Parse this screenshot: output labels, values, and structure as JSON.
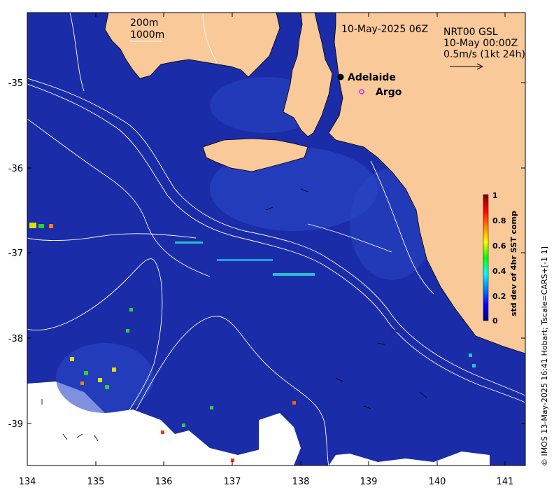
{
  "map": {
    "timestamp": "10-May-2025 06Z",
    "contour_labels": [
      "200m",
      "1000m"
    ],
    "current_source": "NRT00 GSL",
    "current_time": "10-May 00:00Z",
    "vector_scale": "0.5m/s (1kt 24h)",
    "places": [
      {
        "name": "Adelaide",
        "marker": "filled-circle"
      },
      {
        "name": "Argo",
        "marker": "open-circle",
        "color": "#e020e0"
      }
    ],
    "credit": "© IMOS 13-May-2025 16:41 Hobart; Tscale=CARS+[-1 1]",
    "colors": {
      "land": "#f9c99a",
      "ocean": "#1a2ca8",
      "contour": "#ffffff"
    }
  },
  "axes": {
    "x_ticks": [
      "134",
      "135",
      "136",
      "137",
      "138",
      "139",
      "140",
      "141"
    ],
    "y_ticks": [
      "-35",
      "-36",
      "-37",
      "-38",
      "-39"
    ]
  },
  "colorbar": {
    "label": "std dev of 4hr SST comp",
    "ticks": [
      "1",
      "0.8",
      "0.6",
      "0.4",
      "0.2",
      "0"
    ],
    "colormap": "jet"
  },
  "chart_data": {
    "type": "heatmap",
    "title": "10-May-2025 06Z",
    "xlabel": "",
    "ylabel": "",
    "xlim": [
      134,
      141.3
    ],
    "ylim": [
      -39.5,
      -34.2
    ],
    "value_range": [
      0,
      1
    ],
    "colorbar_label": "std dev of 4hr SST comp"
  }
}
